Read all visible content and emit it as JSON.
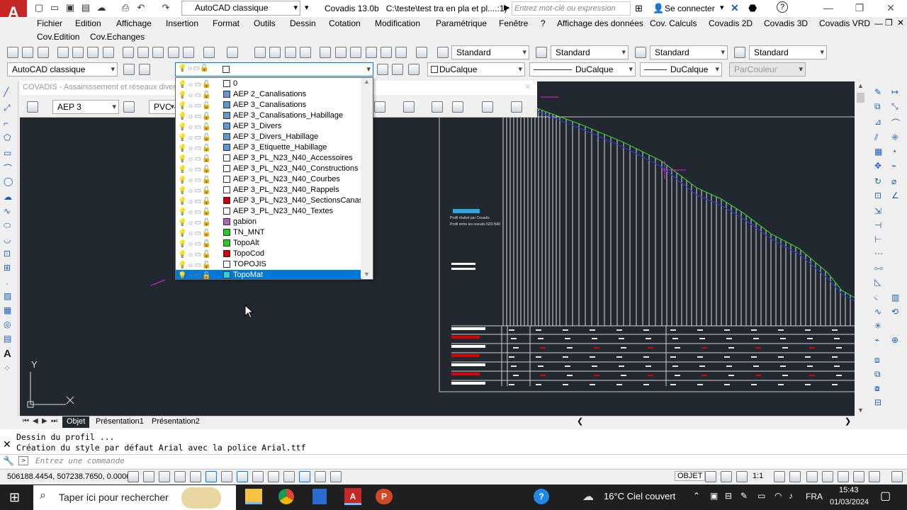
{
  "titlebar": {
    "workspace": "AutoCAD classique",
    "app_version": "Covadis 13.0b",
    "file_path": "C:\\teste\\test tra en pla et pl....:1)",
    "search_placeholder": "Entrez mot-clé ou expression",
    "signin": "Se connecter"
  },
  "menubar": {
    "items": [
      "Fichier",
      "Edition",
      "Affichage",
      "Insertion",
      "Format",
      "Outils",
      "Dessin",
      "Cotation",
      "Modification",
      "Paramétrique",
      "Fenêtre",
      "?",
      "Affichage des données",
      "Cov. Calculs",
      "Covadis 2D",
      "Covadis 3D",
      "Covadis VRD"
    ],
    "items2": [
      "Cov.Edition",
      "Cov.Echanges"
    ]
  },
  "toolbar1": {
    "style1": "Standard",
    "style2": "Standard",
    "style3": "Standard",
    "style4": "Standard"
  },
  "toolbar2": {
    "workspace": "AutoCAD classique",
    "layer_current": "0",
    "color": "DuCalque",
    "linetype": "DuCalque",
    "lineweight": "DuCalque",
    "plotstyle": "ParCouleur"
  },
  "covadis_panel": {
    "title": "COVADIS - Assainissement et réseaux divers",
    "network": "AEP 3",
    "material": "PVC - 2"
  },
  "layers": [
    {
      "name": "0",
      "color": "#ffffff"
    },
    {
      "name": "AEP 2_Canalisations",
      "color": "#5b9bd5"
    },
    {
      "name": "AEP 3_Canalisations",
      "color": "#5b9bd5"
    },
    {
      "name": "AEP 3_Canalisations_Habillage",
      "color": "#5b9bd5"
    },
    {
      "name": "AEP 3_Divers",
      "color": "#5b9bd5"
    },
    {
      "name": "AEP 3_Divers_Habillage",
      "color": "#5b9bd5"
    },
    {
      "name": "AEP 3_Etiquette_Habillage",
      "color": "#5b9bd5"
    },
    {
      "name": "AEP 3_PL_N23_N40_Accessoires",
      "color": "#ffffff"
    },
    {
      "name": "AEP 3_PL_N23_N40_Constructions",
      "color": "#ffffff"
    },
    {
      "name": "AEP 3_PL_N23_N40_Courbes",
      "color": "#ffffff"
    },
    {
      "name": "AEP 3_PL_N23_N40_Rappels",
      "color": "#ffffff"
    },
    {
      "name": "AEP 3_PL_N23_N40_SectionsCanas",
      "color": "#cc0000"
    },
    {
      "name": "AEP 3_PL_N23_N40_Textes",
      "color": "#ffffff"
    },
    {
      "name": "gabion",
      "color": "#b060c0"
    },
    {
      "name": "TN_MNT",
      "color": "#22cc22"
    },
    {
      "name": "TopoAlt",
      "color": "#22cc22"
    },
    {
      "name": "TopoCod",
      "color": "#cc0000"
    },
    {
      "name": "TOPOJIS",
      "color": "#ffffff"
    },
    {
      "name": "TopoMat",
      "color": "#22d8d8"
    }
  ],
  "selected_layer": "TopoMat",
  "drawing_labels": {
    "line1": "Profil réalisé par Covadis",
    "line2": "Profil entre les noeuds N23-N40"
  },
  "ucs": {
    "y": "Y",
    "x": "X"
  },
  "tabs": [
    "Objet",
    "Présentation1",
    "Présentation2"
  ],
  "command": {
    "history1": "Dessin du profil ...",
    "history2": "Création du style par défaut Arial avec la police Arial.ttf",
    "placeholder": "Entrez une commande"
  },
  "status": {
    "coords": "506188.4454, 507238.7650, 0.0000",
    "space": "OBJET",
    "scale": "1:1"
  },
  "taskbar": {
    "search": "Taper ici pour rechercher",
    "weather": "16°C  Ciel couvert",
    "lang": "FRA",
    "time": "15:43",
    "date": "01/03/2024"
  },
  "colors": {
    "drawing_bg": "#212830",
    "profile_line": "#2ecc2e",
    "profile_blue": "#2a35d0",
    "accent_red": "#d80000",
    "selection": "#0078d7"
  }
}
